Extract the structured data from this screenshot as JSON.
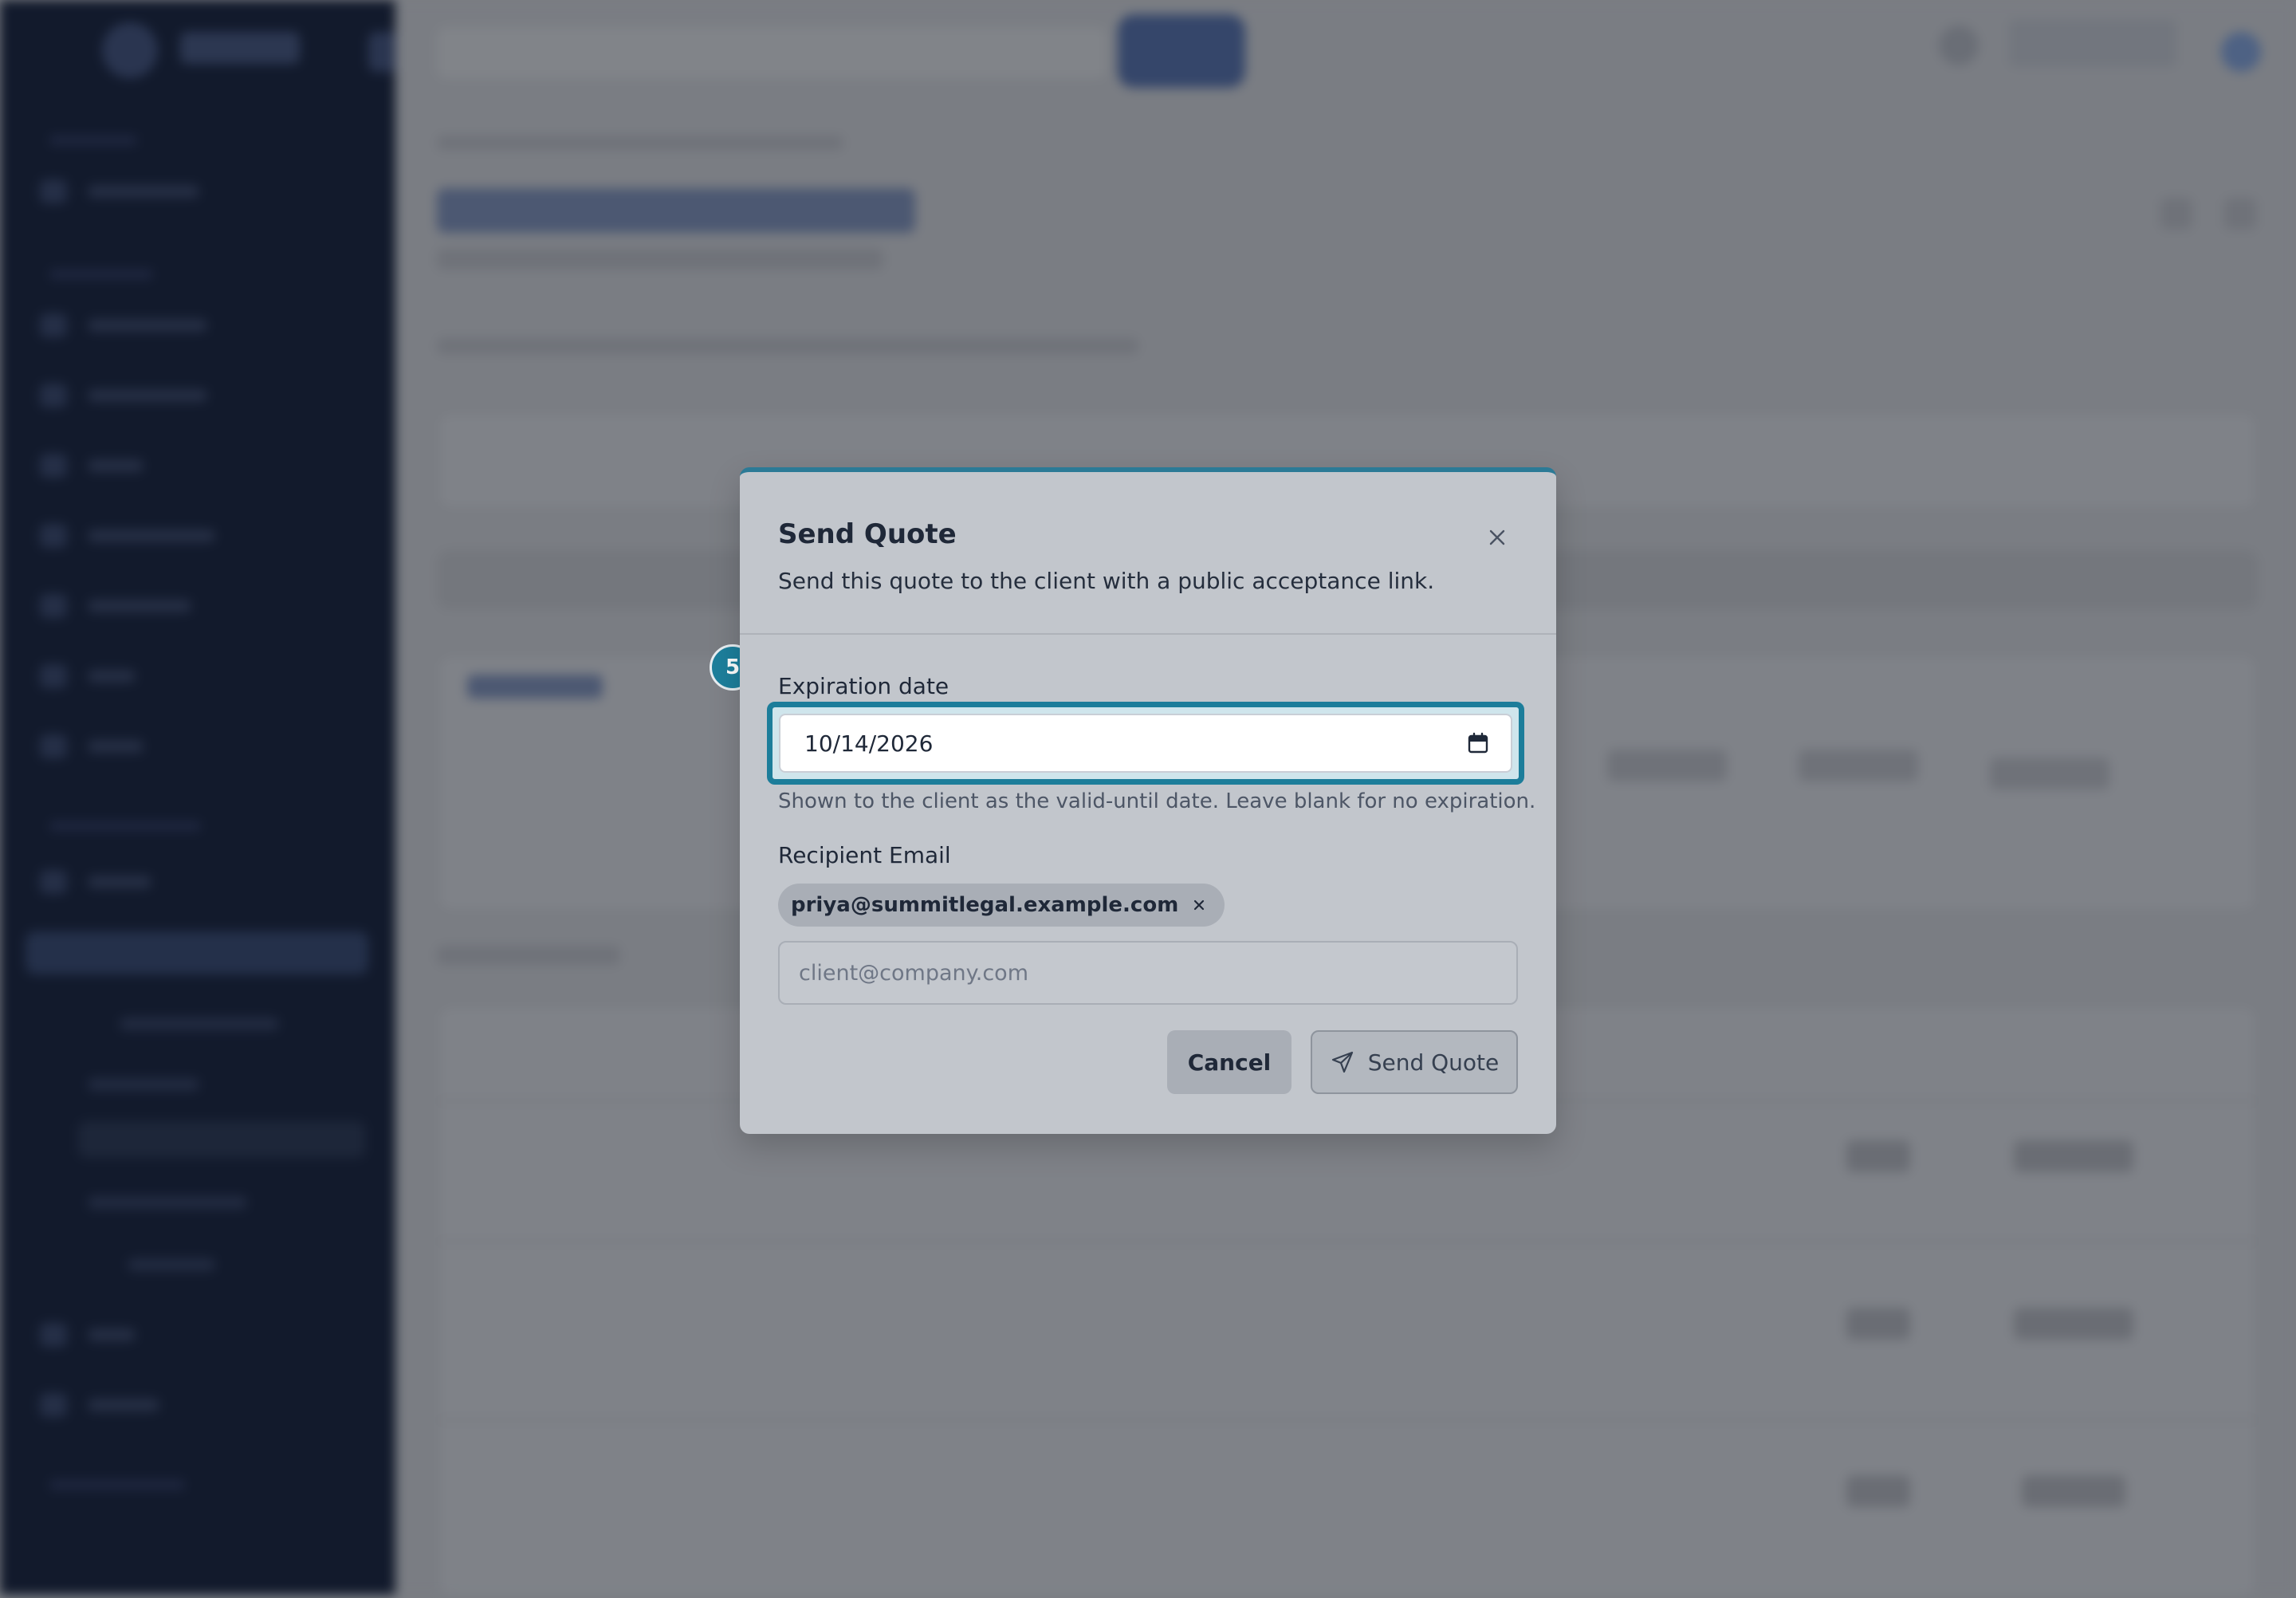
{
  "modal": {
    "title": "Send Quote",
    "subtitle": "Send this quote to the client with a public acceptance link.",
    "close_icon": "close-icon",
    "step_badge": "5",
    "expiration": {
      "label": "Expiration date",
      "value": "10/14/2026",
      "hint": "Shown to the client as the valid-until date. Leave blank for no expiration.",
      "icon": "calendar-icon"
    },
    "recipient": {
      "label": "Recipient Email",
      "chips": [
        "priya@summitlegal.example.com"
      ],
      "placeholder": "client@company.com",
      "value": ""
    },
    "buttons": {
      "cancel": "Cancel",
      "send": "Send Quote",
      "send_icon": "send-icon"
    }
  },
  "colors": {
    "accent": "#1c7d9a",
    "modal_bg": "#c2c6cc",
    "sidebar_bg": "#121a2c",
    "overlay": "#7a7d83"
  }
}
